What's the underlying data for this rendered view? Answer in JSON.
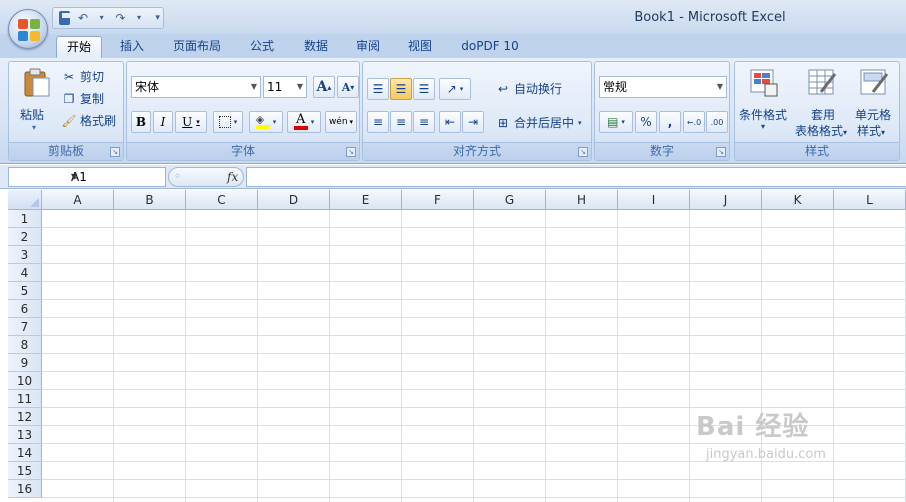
{
  "window": {
    "title": "Book1 - Microsoft Excel"
  },
  "tabs": [
    "开始",
    "插入",
    "页面布局",
    "公式",
    "数据",
    "审阅",
    "视图",
    "doPDF 10"
  ],
  "clipboard": {
    "paste": "粘贴",
    "cut": "剪切",
    "copy": "复制",
    "format_painter": "格式刷",
    "label": "剪贴板"
  },
  "font": {
    "name": "宋体",
    "size": "11",
    "bold": "B",
    "italic": "I",
    "underline": "U",
    "label": "字体",
    "grow": "A",
    "shrink": "A",
    "font_color_letter": "A",
    "phonetic": "wén"
  },
  "alignment": {
    "wrap": "自动换行",
    "merge": "合并后居中",
    "label": "对齐方式"
  },
  "number": {
    "format": "常规",
    "percent": "%",
    "comma": ",",
    "label": "数字"
  },
  "styles": {
    "conditional": "条件格式",
    "table_line1": "套用",
    "table_line2": "表格格式",
    "cell_line1": "单元格",
    "cell_line2": "样式",
    "label": "样式"
  },
  "formula_bar": {
    "name_box": "A1",
    "fx": "fx"
  },
  "columns": [
    "A",
    "B",
    "C",
    "D",
    "E",
    "F",
    "G",
    "H",
    "I",
    "J",
    "K",
    "L"
  ],
  "rows": [
    "1",
    "2",
    "3",
    "4",
    "5",
    "6",
    "7",
    "8",
    "9",
    "10",
    "11",
    "12",
    "13",
    "14",
    "15",
    "16"
  ],
  "watermark": {
    "logo": "Bai 经验",
    "url": "jingyan.baidu.com"
  },
  "colors": {
    "accent": "#15428b",
    "ribbon": "#dde8f7",
    "grid": "#d6dfec"
  }
}
